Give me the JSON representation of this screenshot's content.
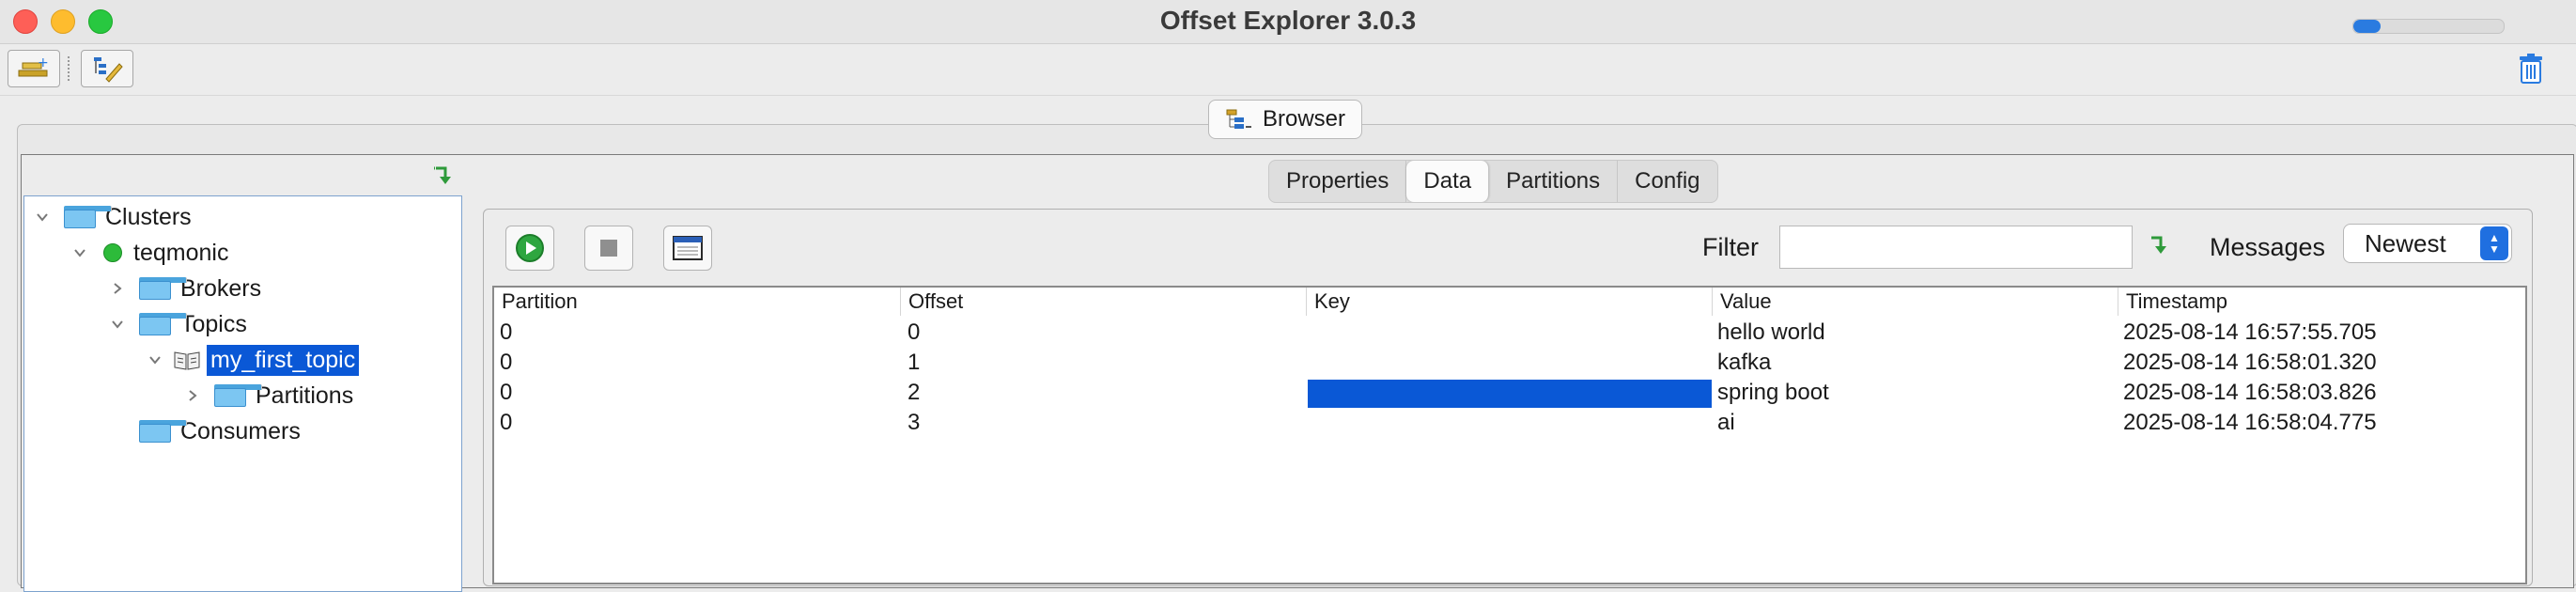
{
  "window": {
    "title": "Offset Explorer  3.0.3"
  },
  "toolbar": {
    "add_cluster_icon": "add-cluster-icon",
    "edit_icon": "edit-icon",
    "trash_icon": "trash-icon",
    "progress_fraction": 0.18
  },
  "browser": {
    "label": "Browser"
  },
  "tree": {
    "root": "Clusters",
    "cluster": "teqmonic",
    "brokers": "Brokers",
    "topics": "Topics",
    "topic": "my_first_topic",
    "partitions": "Partitions",
    "consumers": "Consumers"
  },
  "tabs": [
    {
      "label": "Properties"
    },
    {
      "label": "Data"
    },
    {
      "label": "Partitions"
    },
    {
      "label": "Config"
    }
  ],
  "controls": {
    "filter_label": "Filter",
    "filter_value": "",
    "messages_label": "Messages",
    "messages_selected": "Newest"
  },
  "table": {
    "columns": [
      "Partition",
      "Offset",
      "Key",
      "Value",
      "Timestamp"
    ],
    "rows": [
      {
        "partition": "0",
        "offset": "0",
        "key": "",
        "value": "hello world",
        "timestamp": "2025-08-14 16:57:55.705"
      },
      {
        "partition": "0",
        "offset": "1",
        "key": "",
        "value": "kafka",
        "timestamp": "2025-08-14 16:58:01.320"
      },
      {
        "partition": "0",
        "offset": "2",
        "key": "",
        "value": "spring boot",
        "timestamp": "2025-08-14 16:58:03.826"
      },
      {
        "partition": "0",
        "offset": "3",
        "key": "",
        "value": "ai",
        "timestamp": "2025-08-14 16:58:04.775"
      }
    ]
  }
}
